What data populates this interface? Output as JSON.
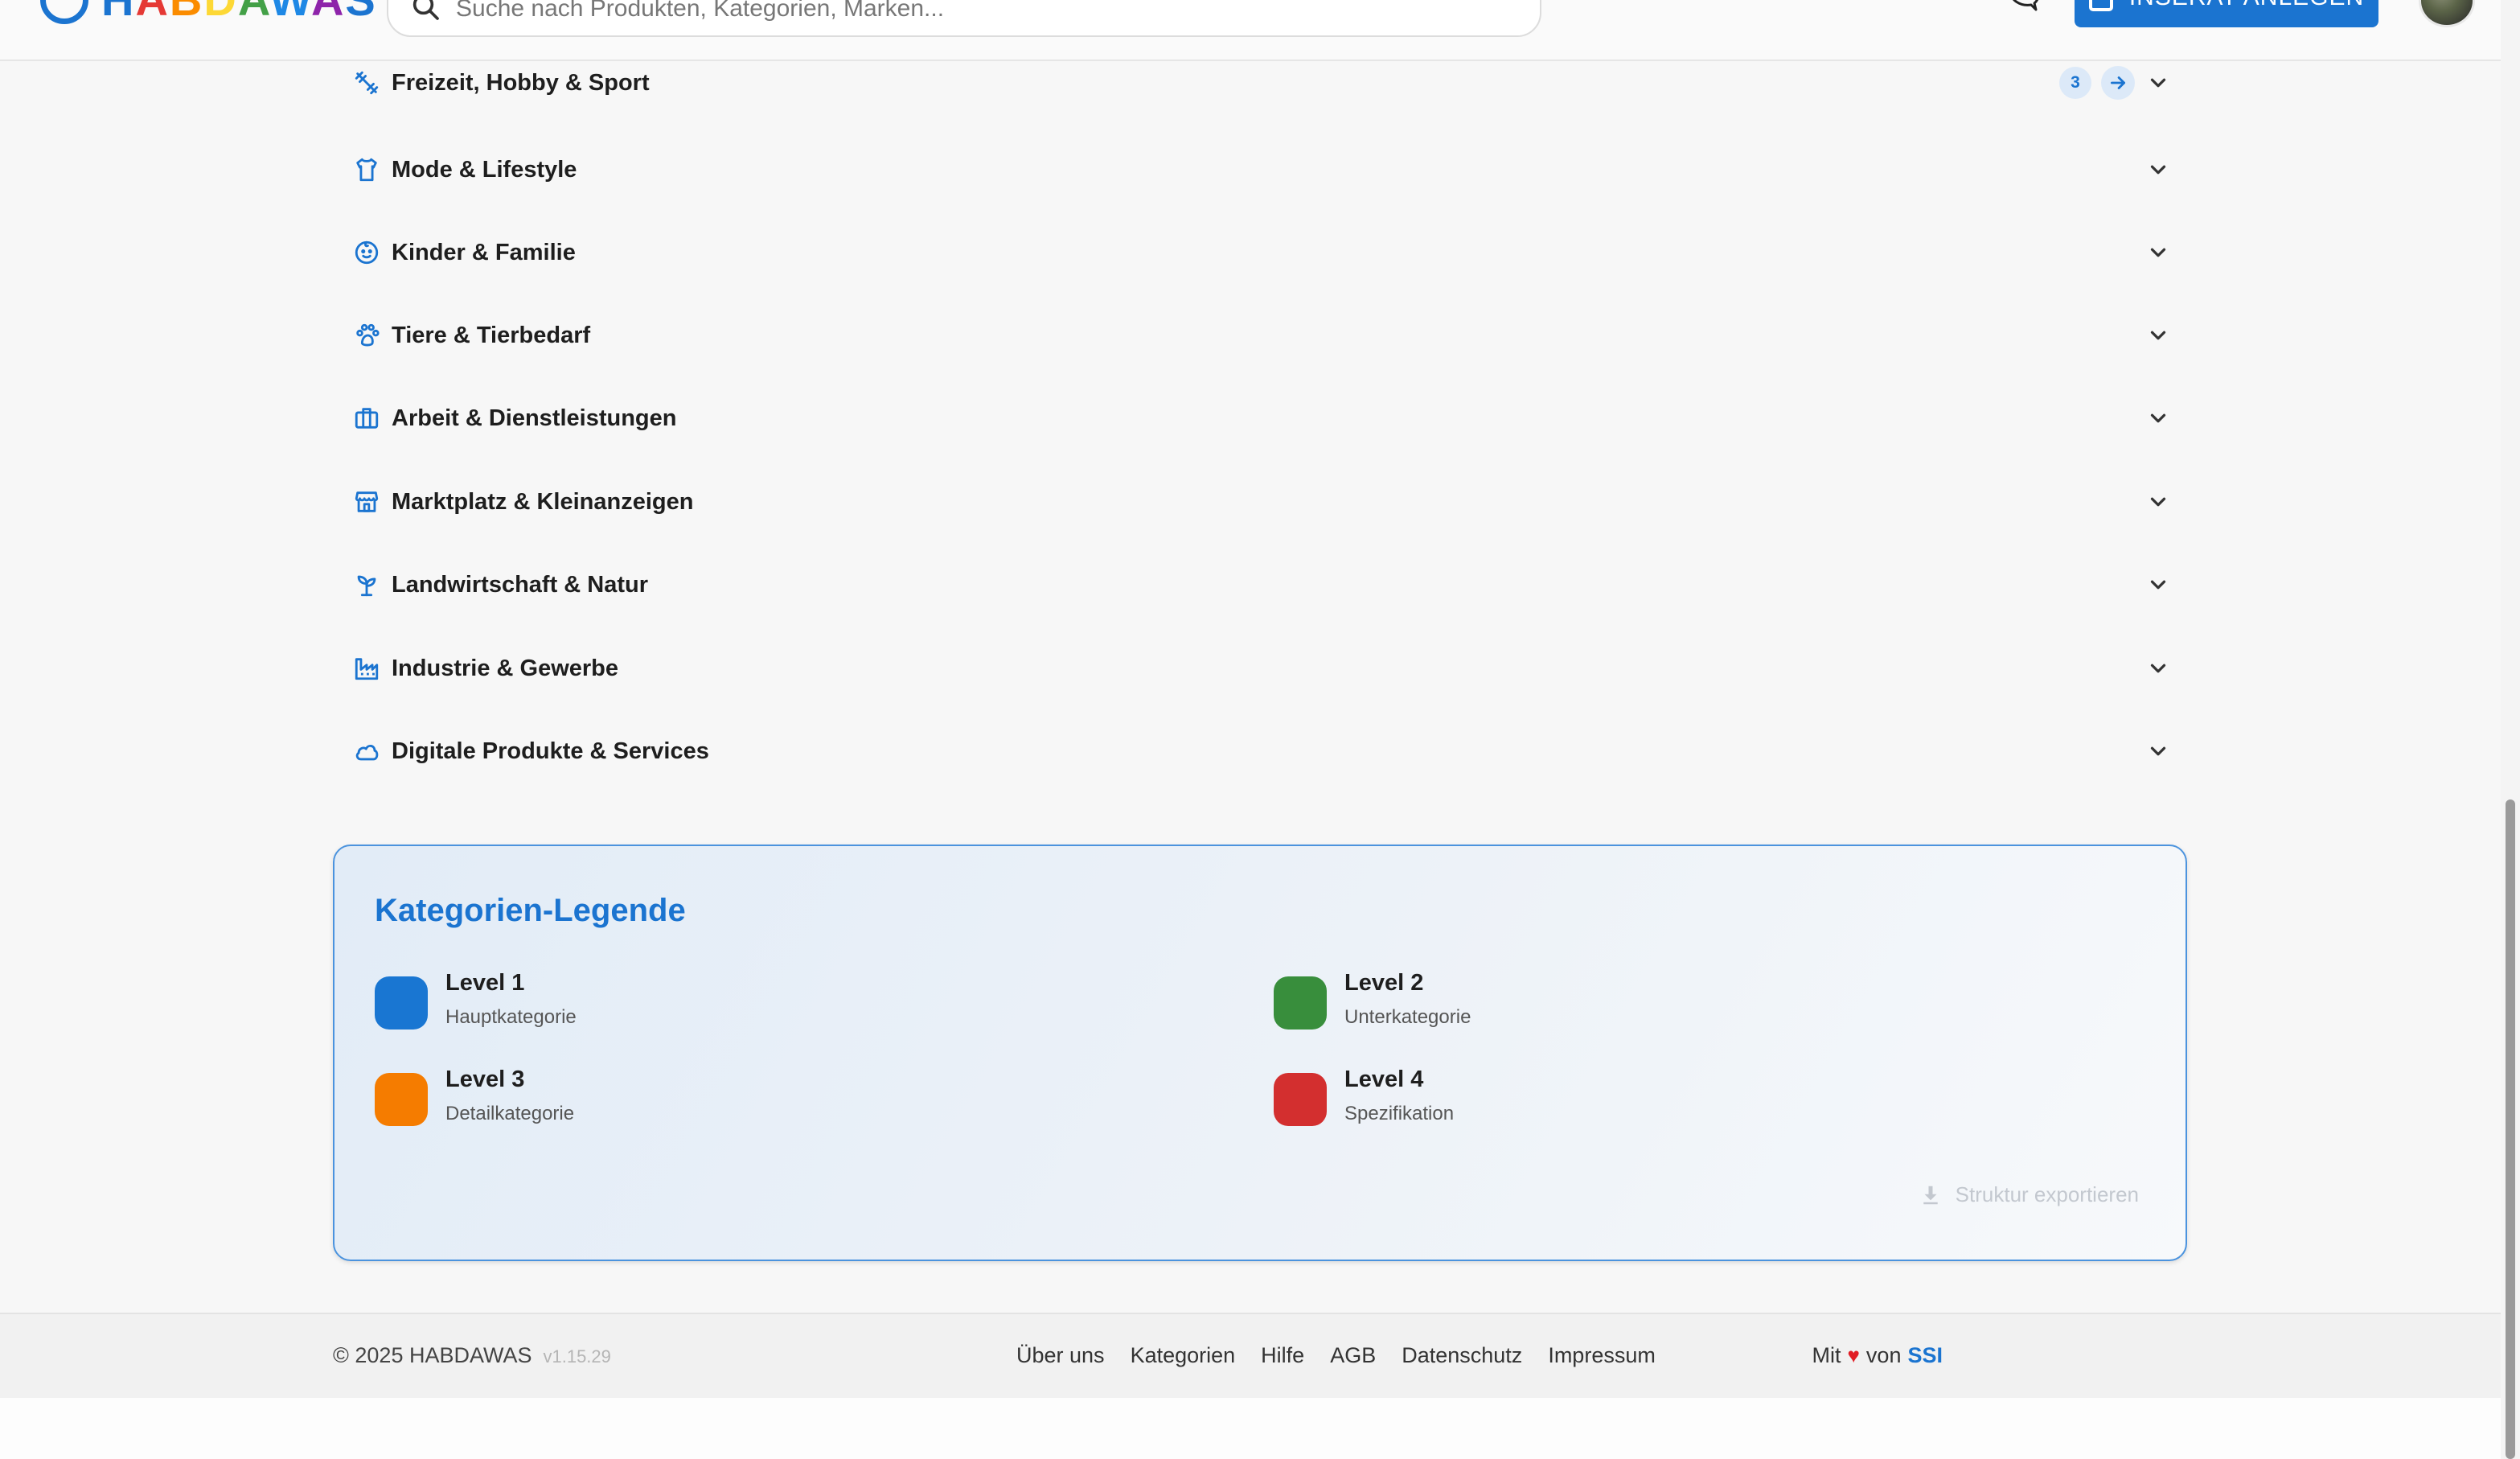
{
  "header": {
    "logo_text": "HABDAWAS",
    "logo_letter_colors": [
      "#1b74d0",
      "#e53935",
      "#fb8c00",
      "#fdd835",
      "#43a047",
      "#1e88e5",
      "#8e24aa",
      "#1b74d0"
    ],
    "search_placeholder": "Suche nach Produkten, Kategorien, Marken...",
    "cta_label": "INSERAT ANLEGEN",
    "accent_color": "#1b74d0"
  },
  "categories": [
    {
      "label": "Freizeit, Hobby & Sport",
      "icon": "sport-icon",
      "count": "3",
      "has_goto": true
    },
    {
      "label": "Mode & Lifestyle",
      "icon": "shirt-icon"
    },
    {
      "label": "Kinder & Familie",
      "icon": "baby-face-icon"
    },
    {
      "label": "Tiere & Tierbedarf",
      "icon": "paw-icon"
    },
    {
      "label": "Arbeit & Dienstleistungen",
      "icon": "briefcase-icon"
    },
    {
      "label": "Marktplatz & Kleinanzeigen",
      "icon": "store-icon"
    },
    {
      "label": "Landwirtschaft & Natur",
      "icon": "sprout-icon"
    },
    {
      "label": "Industrie & Gewerbe",
      "icon": "factory-icon"
    },
    {
      "label": "Digitale Produkte & Services",
      "icon": "cloud-icon"
    }
  ],
  "legend": {
    "title": "Kategorien-Legende",
    "levels": [
      {
        "title": "Level 1",
        "subtitle": "Hauptkategorie",
        "color": "#1976d2"
      },
      {
        "title": "Level 2",
        "subtitle": "Unterkategorie",
        "color": "#388e3c"
      },
      {
        "title": "Level 3",
        "subtitle": "Detailkategorie",
        "color": "#f57c00"
      },
      {
        "title": "Level 4",
        "subtitle": "Spezifikation",
        "color": "#d32f2f"
      }
    ],
    "export_label": "Struktur exportieren"
  },
  "footer": {
    "copyright": "© 2025 HABDAWAS",
    "version": "v1.15.29",
    "links": [
      "Über uns",
      "Kategorien",
      "Hilfe",
      "AGB",
      "Datenschutz",
      "Impressum"
    ],
    "credit_prefix": "Mit",
    "credit_middle": "von",
    "credit_brand": "SSI"
  }
}
